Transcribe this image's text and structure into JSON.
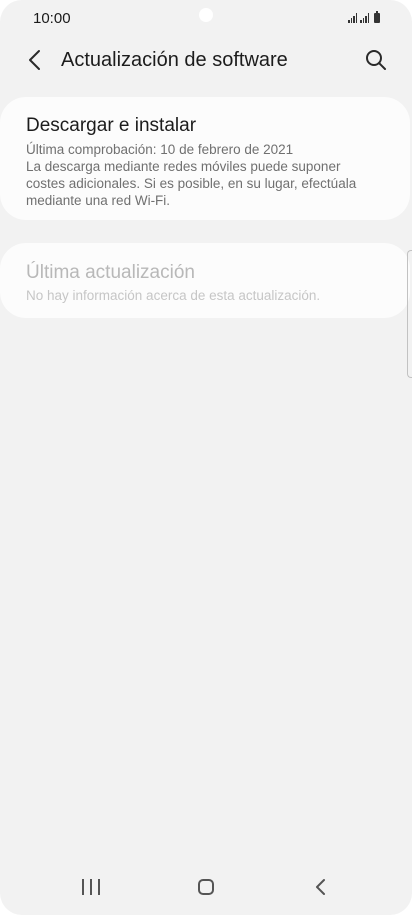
{
  "status_bar": {
    "time": "10:00"
  },
  "app_bar": {
    "title": "Actualización de software",
    "back_icon": "chevron-left-icon",
    "search_icon": "search-icon"
  },
  "download_card": {
    "title": "Descargar e instalar",
    "lines": [
      "Última comprobación: 10 de febrero de 2021",
      "La descarga mediante redes móviles puede suponer",
      "costes adicionales. Si es posible, en su lugar, efectúala",
      "mediante una red Wi-Fi."
    ]
  },
  "last_update_card": {
    "title": "Última actualización",
    "subtitle": "No hay información acerca de esta actualización.",
    "enabled": false
  },
  "nav_bar": {
    "recents_icon": "recents-icon",
    "home_icon": "home-icon",
    "back_icon": "back-icon"
  }
}
